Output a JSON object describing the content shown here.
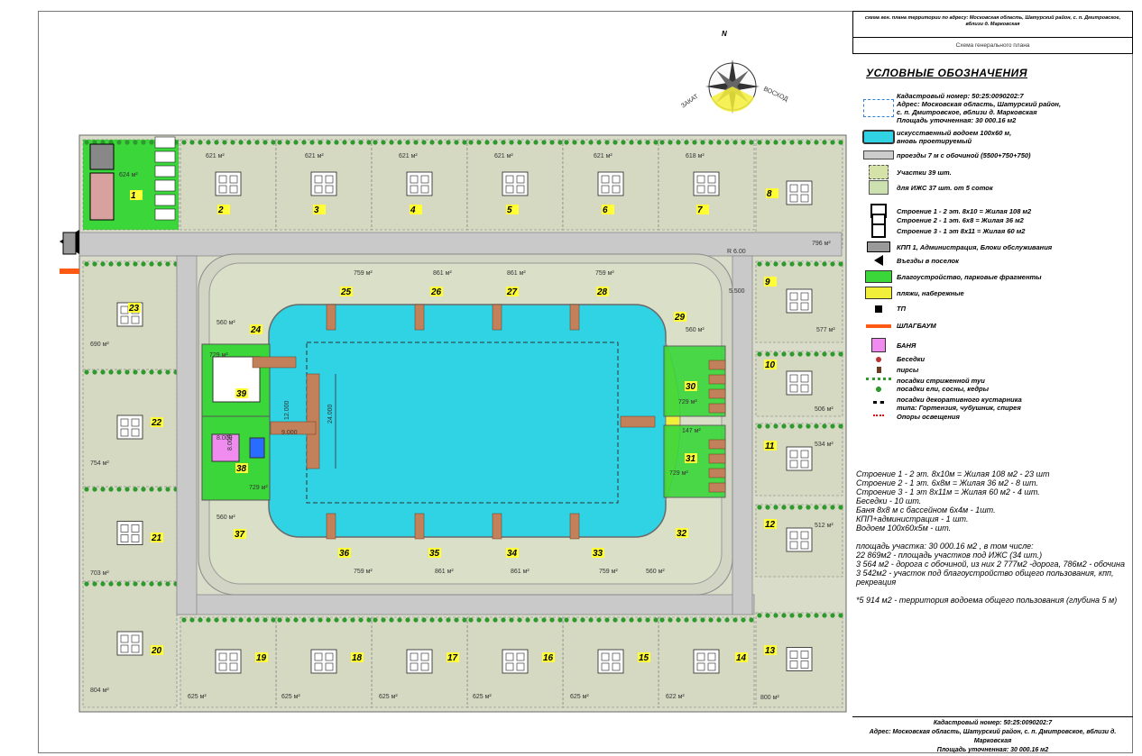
{
  "title_block": {
    "title": "схема ген. плана территории  по адресу: Московская область, Шатурский район, с. п. Дмитровское, вблизи д. Марковская",
    "subtitle": "Схема генерального плана"
  },
  "compass": {
    "north": "N",
    "zakat": "ЗАКАТ",
    "voskhod": "ВОСХОД"
  },
  "legend": {
    "title": "УСЛОВНЫЕ  ОБОЗНАЧЕНИЯ",
    "items": [
      {
        "symbol": "dashed-blue-rect-icon",
        "text": "Кадастровый номер: 50:25:0090202:7\nАдрес: Московская область, Шатурский район,\nс. п. Дмитровское, вблизи д. Марковская\nПлощадь уточненная: 30 000.16 м2"
      },
      {
        "symbol": "water-icon",
        "text": "искусственный водоем 100х60 м,\nвновь проетируемый"
      },
      {
        "symbol": "road-icon",
        "text": "проезды 7 м с обочиной (5500+750+750)"
      },
      {
        "symbol": "plot-icon",
        "text": "Участки 39 шт."
      },
      {
        "symbol": "plot-izhs-icon",
        "text": "для ИЖС 37 шт. от 5 соток"
      },
      {
        "symbol": "house1-icon",
        "text": "Строение 1 - 2 эт. 8х10 = Жилая 108 м2"
      },
      {
        "symbol": "house2-icon",
        "text": "Строение 2 - 1 эт. 6х8 = Жилая 36 м2"
      },
      {
        "symbol": "house3-icon",
        "text": "Строение 3 - 1 эт 8х11 = Жилая 60 м2"
      },
      {
        "symbol": "kpp-icon",
        "text": "КПП 1, Администрация, Блоки обслуживания"
      },
      {
        "symbol": "entry-arrow-icon",
        "text": "Въезды в поселок"
      },
      {
        "symbol": "green-area-icon",
        "text": "Благоустройство, парковые фрагменты"
      },
      {
        "symbol": "beach-icon",
        "text": "пляжи, набережные"
      },
      {
        "symbol": "tp-icon",
        "text": "ТП"
      },
      {
        "symbol": "barrier-icon",
        "text": "ШЛАГБАУМ"
      },
      {
        "symbol": "banya-icon",
        "text": "БАНЯ"
      },
      {
        "symbol": "gazebo-icon",
        "text": "Беседки"
      },
      {
        "symbol": "pier-icon",
        "text": "пирсы"
      },
      {
        "symbol": "thuja-icon",
        "text": "посадки стриженной туи"
      },
      {
        "symbol": "conifer-icon",
        "text": "посадки ели, сосны, кедры"
      },
      {
        "symbol": "shrub-icon",
        "text": "посадки декоративного кустарника\nтипа: Гортензия, чубушник, спирея"
      },
      {
        "symbol": "lamp-icon",
        "text": "Опоры освещения"
      }
    ]
  },
  "summary": [
    "Строение 1 - 2 эт. 8х10м = Жилая 108 м2  - 23 шт",
    "Строение 2 - 1 эт. 6х8м = Жилая 36 м2 - 8 шт.",
    "Строение 3 - 1 эт 8х11м = Жилая 60 м2  - 4 шт.",
    "Беседки  - 10 шт.",
    "Баня 8х8 м с бассейном 6х4м - 1шт.",
    "КПП+администрация - 1 шт.",
    "Водоем 100х60х5м - шт.",
    "",
    "площадь участка:  30 000.16 м2 ,  в том числе:",
    "22 869м2 - площадь участков под ИЖС (34 шт.)",
    "3 564 м2 - дорога с обочиной, из них 2 777м2 -дорога, 786м2 - обочина",
    "3 542м2 - участок под благоустройство  общего пользования, кпп, рекреация",
    "",
    "*5 914 м2 - территория водоема общего пользования (глубина 5 м)"
  ],
  "stamp": {
    "line1": "Кадастровый номер: 50:25:0090202:7",
    "line2": "Адрес: Московская область, Шатурский район, с. п. Дмитровское, вблизи д. Марковская",
    "line3": "Площадь уточненная: 30 000.16 м2"
  },
  "map": {
    "dimensions": {
      "r": "R 6.00",
      "w": "5.500",
      "lake_len": "24.000",
      "pier_a": "12.000",
      "pier_b": "9.000",
      "banya_a": "8.000",
      "banya_b": "8.000",
      "beach_area": "147 м²"
    },
    "plots": [
      {
        "n": "1",
        "area": "624 м²"
      },
      {
        "n": "2",
        "area": "621 м²"
      },
      {
        "n": "3",
        "area": "621 м²"
      },
      {
        "n": "4",
        "area": "621 м²"
      },
      {
        "n": "5",
        "area": "621 м²"
      },
      {
        "n": "6",
        "area": "621 м²"
      },
      {
        "n": "7",
        "area": "618 м²"
      },
      {
        "n": "8",
        "area": "796 м²"
      },
      {
        "n": "9",
        "area": "577 м²"
      },
      {
        "n": "10",
        "area": "506 м²"
      },
      {
        "n": "11",
        "area": "534 м²"
      },
      {
        "n": "12",
        "area": "512 м²"
      },
      {
        "n": "13",
        "area": "800 м²"
      },
      {
        "n": "14",
        "area": "622 м²"
      },
      {
        "n": "15",
        "area": "625 м²"
      },
      {
        "n": "16",
        "area": "625 м²"
      },
      {
        "n": "17",
        "area": "625 м²"
      },
      {
        "n": "18",
        "area": "625 м²"
      },
      {
        "n": "19",
        "area": "625 м²"
      },
      {
        "n": "20",
        "area": "804 м²"
      },
      {
        "n": "21",
        "area": "703 м²"
      },
      {
        "n": "22",
        "area": "754 м²"
      },
      {
        "n": "23",
        "area": "690 м²"
      },
      {
        "n": "24",
        "area": "560 м²"
      },
      {
        "n": "25",
        "area": "759 м²"
      },
      {
        "n": "26",
        "area": "861 м²"
      },
      {
        "n": "27",
        "area": "861 м²"
      },
      {
        "n": "28",
        "area": "759 м²"
      },
      {
        "n": "29",
        "area": "560 м²"
      },
      {
        "n": "30",
        "area": "729 м²"
      },
      {
        "n": "31",
        "area": "729 м²"
      },
      {
        "n": "32",
        "area": "560 м²"
      },
      {
        "n": "33",
        "area": "759 м²"
      },
      {
        "n": "34",
        "area": "861 м²"
      },
      {
        "n": "35",
        "area": "861 м²"
      },
      {
        "n": "36",
        "area": "759 м²"
      },
      {
        "n": "37",
        "area": "560 м²"
      },
      {
        "n": "38",
        "area": "729 м²"
      },
      {
        "n": "39",
        "area": "729 м²"
      }
    ]
  }
}
